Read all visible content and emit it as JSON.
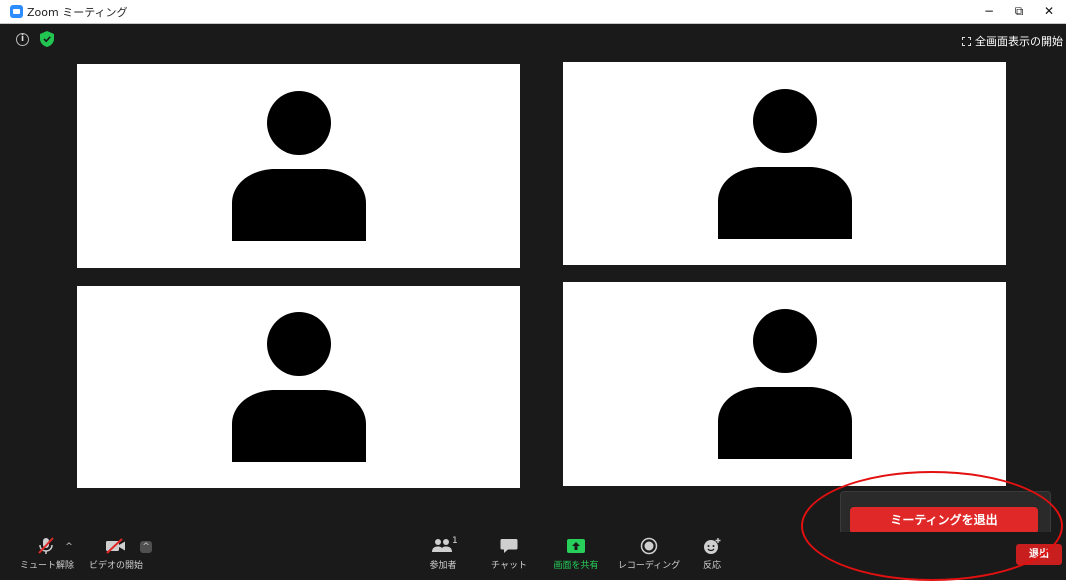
{
  "window": {
    "title": "Zoom ミーティング",
    "minimize": "−",
    "restore": "⧉",
    "close": "✕"
  },
  "status": {
    "info": "i",
    "fullscreen_label": "全画面表示の開始"
  },
  "tiles": [
    {
      "name": "participant-1"
    },
    {
      "name": "participant-2"
    },
    {
      "name": "participant-3"
    },
    {
      "name": "participant-4"
    }
  ],
  "popup": {
    "leave_meeting_label": "ミーティングを退出"
  },
  "toolbar": {
    "unmute_label": "ミュート解除",
    "start_video_label": "ビデオの開始",
    "participants_label": "参加者",
    "participants_count": "1",
    "chat_label": "チャット",
    "share_label": "画面を共有",
    "record_label": "レコーディング",
    "reactions_label": "反応",
    "exit_label": "退出",
    "caret": "^"
  },
  "colors": {
    "accent_red": "#e02828",
    "share_green": "#26d05a",
    "shield_green": "#23c552",
    "background": "#1a1a1a"
  }
}
